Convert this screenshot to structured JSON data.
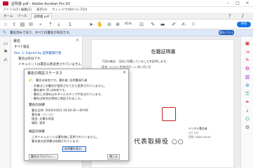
{
  "window": {
    "title": "証明書.pdf - Adobe Acrobat Pro DC"
  },
  "menu": [
    "ファイル(F)",
    "編集(E)",
    "表示(V)",
    "ウィンドウ(W)",
    "ヘルプ(H)"
  ],
  "tabs": {
    "home": "ホーム",
    "tools": "ツール",
    "doc": "証明書.pdf"
  },
  "toolbar": {
    "zoom": "85%",
    "icons": [
      "star-icon",
      "upload-icon",
      "print-icon",
      "search-icon",
      "back-icon",
      "forward-icon",
      "page-up-icon",
      "page-down-icon",
      "hand-icon",
      "zoom-out-icon",
      "zoom-in-icon",
      "comment-icon",
      "highlight-icon",
      "sign-icon",
      "share-icon"
    ],
    "share_label": "共有"
  },
  "sigbar": {
    "message": "署名済みであり、すべての署名が有効です。",
    "panel_button": "署名パネル"
  },
  "sigpanel": {
    "header": "署名",
    "lines": [
      "すべて検証",
      "Rev. 1: Signed by 証明書発行者",
      "署名は有効です:",
      "ドキュメントは署名以降変更されていません",
      "署名者の ID は有効です",
      "署名日時: 2020/10/01"
    ]
  },
  "page": {
    "title": "在籍証明書",
    "paragraphs": [
      "下記の者は、当社に在籍していることを証明します。",
      "氏名: ○○○○  生年月日: ○○年○月○日",
      "所属: ○○部○○課"
    ],
    "signature_script": "代表取締役 ○○",
    "sign_info": [
      "デジタル署名者:",
      "○○ ○○",
      "日付: 2020.10.01"
    ]
  },
  "dialog": {
    "title": "署名の検証ステータス",
    "summary": "署名は有効です。署名者: 証明書発行者",
    "lines": [
      "- 文書はこの署名が適用されてから変更されていません。",
      "- 署名者の ID は有効です。",
      "- 署名には埋め込みタイムスタンプが含まれています。",
      "- 署名は有効な時刻に検証されました。"
    ],
    "section1": "署名の詳細",
    "section1_lines": [
      "署名日時: 2020/10/01 10:20:30 +09'00'",
      "署名者: ○○ ○○",
      "理由: 文書の承認",
      "場所: 東京"
    ],
    "section2": "検証の詳細",
    "section2_lines": [
      "このドキュメントは署名後に変更されていません。",
      "署名者の証明書は信頼されています。"
    ],
    "buttons": {
      "properties": "署名のプロパティ...",
      "close": "閉じる",
      "view_cert": "証明書を表示..."
    }
  },
  "colors": {
    "accent": "#1473e6",
    "sigbar_bg": "#dde8f7",
    "seal": "#b22222"
  }
}
